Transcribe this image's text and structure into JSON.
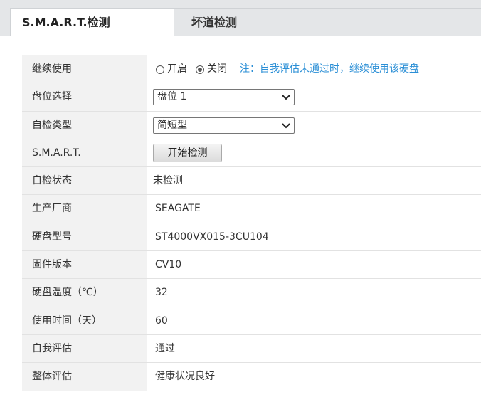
{
  "tabs": {
    "smart": "S.M.A.R.T.检测",
    "badtrack": "坏道检测"
  },
  "form": {
    "continue_use": {
      "label": "继续使用",
      "option_on": "开启",
      "option_off": "关闭",
      "selected": "关闭",
      "note": "注：自我评估未通过时，继续使用该硬盘"
    },
    "disk_select": {
      "label": "盘位选择",
      "value": "盘位 1"
    },
    "selftest_type": {
      "label": "自检类型",
      "value": "简短型"
    },
    "smart": {
      "label": "S.M.A.R.T.",
      "button": "开始检测"
    },
    "selftest_status": {
      "label": "自检状态",
      "value": "未检测"
    },
    "manufacturer": {
      "label": "生产厂商",
      "value": "SEAGATE"
    },
    "model": {
      "label": "硬盘型号",
      "value": "ST4000VX015-3CU104"
    },
    "firmware": {
      "label": "固件版本",
      "value": "CV10"
    },
    "temperature": {
      "label": "硬盘温度（℃）",
      "value": "32"
    },
    "usage_time": {
      "label": "使用时间（天）",
      "value": "60"
    },
    "self_assessment": {
      "label": "自我评估",
      "value": "通过"
    },
    "overall_assessment": {
      "label": "整体评估",
      "value": "健康状况良好"
    }
  },
  "colors": {
    "note": "#2b8fd6",
    "label_bg": "#f2f2f2",
    "tabbar_bg": "#e4e6e8"
  }
}
